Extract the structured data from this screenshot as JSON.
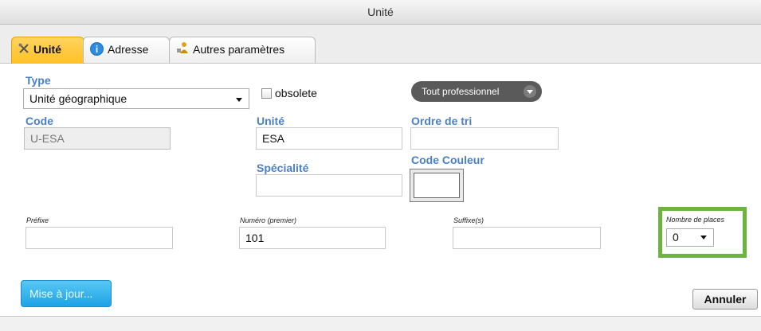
{
  "window": {
    "title": "Unité"
  },
  "tabs": [
    {
      "label": "Unité",
      "icon": "tools-icon",
      "active": true
    },
    {
      "label": "Adresse",
      "icon": "info-icon",
      "active": false
    },
    {
      "label": "Autres paramètres",
      "icon": "settings-person-icon",
      "active": false
    }
  ],
  "form": {
    "type": {
      "label": "Type",
      "value": "Unité géographique"
    },
    "obsolete": {
      "label": "obsolete",
      "checked": false
    },
    "filter_button": {
      "label": "Tout professionnel"
    },
    "code": {
      "label": "Code",
      "value": "U-ESA"
    },
    "unite": {
      "label": "Unité",
      "value": "ESA"
    },
    "ordre_tri": {
      "label": "Ordre de tri",
      "value": ""
    },
    "specialite": {
      "label": "Spécialité",
      "value": ""
    },
    "code_couleur": {
      "label": "Code Couleur",
      "color": "#ffffff"
    },
    "prefixe": {
      "label": "Préfixe",
      "value": ""
    },
    "numero": {
      "label": "Numéro (premier)",
      "value": "101"
    },
    "suffixe": {
      "label": "Suffixe(s)",
      "value": ""
    },
    "nombre_places": {
      "label": "Nombre de places",
      "value": "0",
      "highlight_color": "#6db33f"
    }
  },
  "actions": {
    "update_label": "Mise à jour...",
    "cancel_label": "Annuler"
  },
  "colors": {
    "label_blue": "#4a80c6",
    "active_tab": "#ffc126",
    "update_button": "#1ea3e6"
  }
}
